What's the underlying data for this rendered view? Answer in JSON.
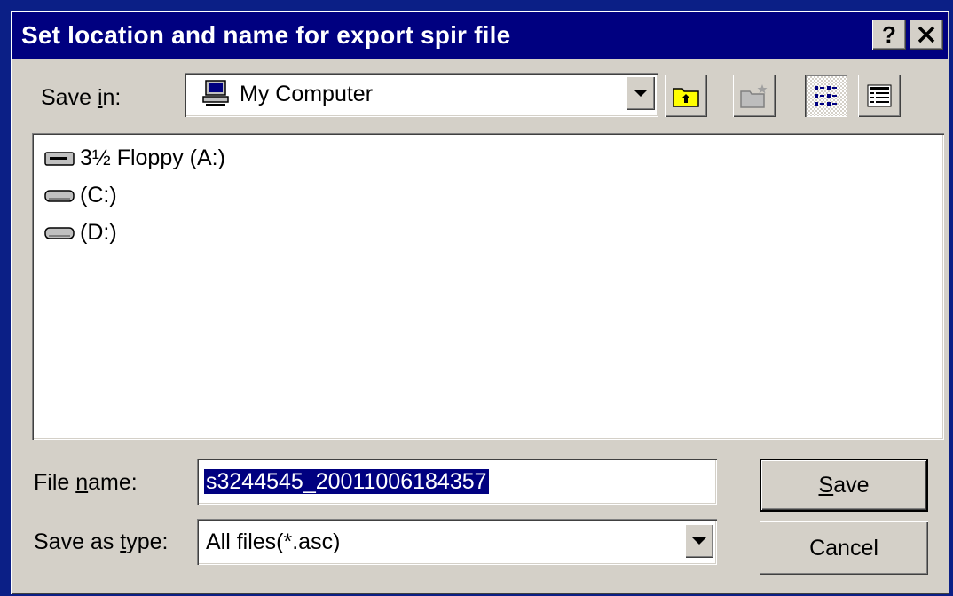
{
  "window": {
    "title": "Set location and name for export spir file",
    "help_button": "?",
    "close_button": "✕"
  },
  "save_in": {
    "label_pre": "Save ",
    "label_accel": "i",
    "label_post": "n:",
    "value": "My Computer",
    "icon": "computer-icon"
  },
  "toolbar": {
    "up_one_level_icon": "folder-up-icon",
    "new_folder_icon": "new-folder-icon",
    "list_view_icon": "list-view-icon",
    "details_view_icon": "details-view-icon",
    "pressed": "list_view"
  },
  "files": [
    {
      "label": "3½ Floppy (A:)",
      "icon": "floppy-drive-icon"
    },
    {
      "label": "(C:)",
      "icon": "hard-drive-icon"
    },
    {
      "label": "(D:)",
      "icon": "hard-drive-icon"
    }
  ],
  "file_name": {
    "label_pre": "File ",
    "label_accel": "n",
    "label_post": "ame:",
    "value": "s3244545_20011006184357"
  },
  "save_as_type": {
    "label_pre": "Save as ",
    "label_accel": "t",
    "label_post": "ype:",
    "value": "All files(*.asc)"
  },
  "buttons": {
    "save_accel": "S",
    "save_rest": "ave",
    "cancel": "Cancel"
  },
  "colors": {
    "titlebar": "#000080",
    "face": "#d4d0c8",
    "selection": "#000080",
    "desktop": "#0b1f86"
  }
}
